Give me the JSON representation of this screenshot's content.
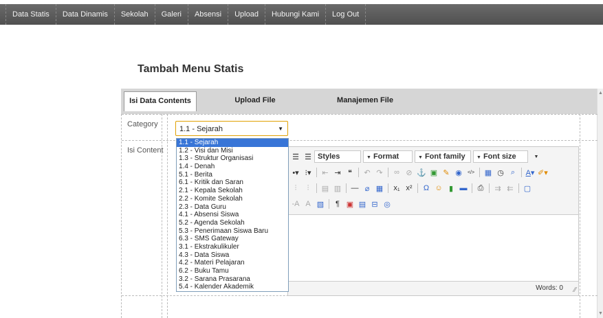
{
  "nav": [
    "Data Statis",
    "Data Dinamis",
    "Sekolah",
    "Galeri",
    "Absensi",
    "Upload",
    "Hubungi Kami",
    "Log Out"
  ],
  "page_title": "Tambah Menu Statis",
  "tabs": [
    "Isi Data Contents",
    "Upload File",
    "Manajemen File"
  ],
  "form": {
    "category_label": "Category",
    "content_label": "Isi Content",
    "category_value": "1.1 - Sejarah",
    "options": [
      "1.1 - Sejarah",
      "1.2 - Visi dan Misi",
      "1.3 - Struktur Organisasi",
      "1.4 - Denah",
      "5.1 - Berita",
      "6.1 - Kritik dan Saran",
      "2.1 - Kepala Sekolah",
      "2.2 - Komite Sekolah",
      "2.3 - Data Guru",
      "4.1 - Absensi Siswa",
      "5.2 - Agenda Sekolah",
      "5.3 - Penerimaan Siswa Baru",
      "6.3 - SMS Gateway",
      "3.1 - Ekstrakulikuler",
      "4.3 - Data Siswa",
      "4.2 - Materi Pelajaran",
      "6.2 - Buku Tamu",
      "3.2 - Sarana Prasarana",
      "5.4 - Kalender Akademik"
    ]
  },
  "editor": {
    "dropdowns": [
      "Styles",
      "Format",
      "Font family",
      "Font size"
    ],
    "word_count": "Words: 0"
  }
}
